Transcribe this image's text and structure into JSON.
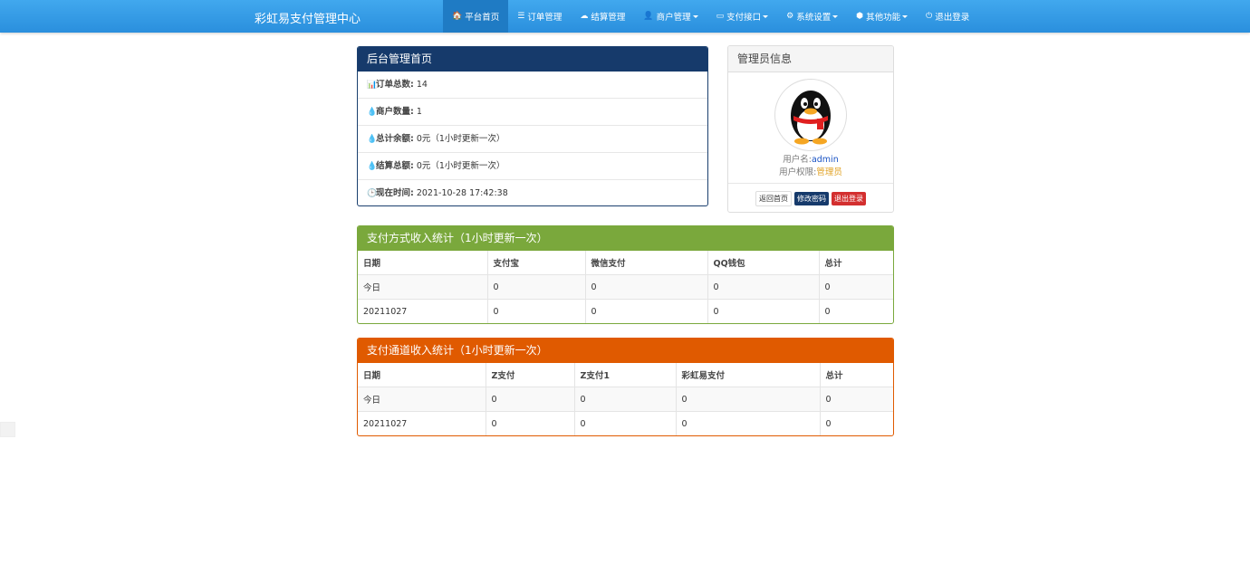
{
  "brand": "彩虹易支付管理中心",
  "nav": [
    {
      "icon": "🏠",
      "label": "平台首页",
      "active": true,
      "caret": false
    },
    {
      "icon": "☰",
      "label": "订单管理",
      "active": false,
      "caret": false
    },
    {
      "icon": "☁",
      "label": "结算管理",
      "active": false,
      "caret": false
    },
    {
      "icon": "👤",
      "label": "商户管理",
      "active": false,
      "caret": true
    },
    {
      "icon": "▭",
      "label": "支付接口",
      "active": false,
      "caret": true
    },
    {
      "icon": "⚙",
      "label": "系统设置",
      "active": false,
      "caret": true
    },
    {
      "icon": "⬢",
      "label": "其他功能",
      "active": false,
      "caret": true
    },
    {
      "icon": "⏻",
      "label": "退出登录",
      "active": false,
      "caret": false
    }
  ],
  "overview": {
    "title": "后台管理首页",
    "rows": [
      {
        "icon": "📊",
        "label": "订单总数:",
        "value": "14"
      },
      {
        "icon": "💧",
        "label": "商户数量:",
        "value": "1"
      },
      {
        "icon": "💧",
        "label": "总计余额:",
        "value": "0元（1小时更新一次）"
      },
      {
        "icon": "💧",
        "label": "结算总额:",
        "value": "0元（1小时更新一次）"
      },
      {
        "icon": "🕒",
        "label": "现在时间:",
        "value": "2021-10-28 17:42:38"
      }
    ]
  },
  "admin": {
    "title": "管理员信息",
    "username_label": "用户名:",
    "username": "admin",
    "role_label": "用户权限:",
    "role": "管理员",
    "btn_home": "返回首页",
    "btn_password": "修改密码",
    "btn_logout": "退出登录"
  },
  "pay_method": {
    "title": "支付方式收入统计（1小时更新一次）",
    "headers": [
      "日期",
      "支付宝",
      "微信支付",
      "QQ钱包",
      "总计"
    ],
    "rows": [
      [
        "今日",
        "0",
        "0",
        "0",
        "0"
      ],
      [
        "20211027",
        "0",
        "0",
        "0",
        "0"
      ]
    ]
  },
  "pay_channel": {
    "title": "支付通道收入统计（1小时更新一次）",
    "headers": [
      "日期",
      "Z支付",
      "Z支付1",
      "彩虹易支付",
      "总计"
    ],
    "rows": [
      [
        "今日",
        "0",
        "0",
        "0",
        "0"
      ],
      [
        "20211027",
        "0",
        "0",
        "0",
        "0"
      ]
    ]
  }
}
